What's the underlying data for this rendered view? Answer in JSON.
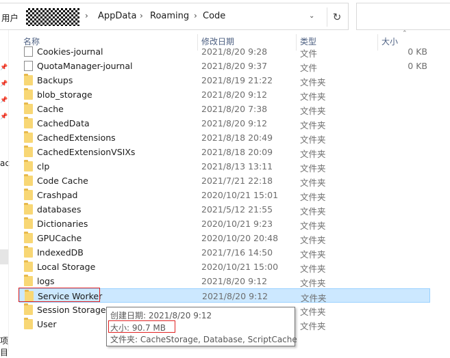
{
  "address": {
    "user_label": "用户",
    "crumbs": [
      "AppData",
      "Roaming",
      "Code"
    ],
    "separator": "›",
    "dropdown": "⌄",
    "refresh": "↻"
  },
  "nav": {
    "pin": "📌",
    "partial_label": "ac",
    "count_label": "项目"
  },
  "columns": {
    "name": "名称",
    "date": "修改日期",
    "type": "类型",
    "size": "大小"
  },
  "rows": [
    {
      "name": "Cookies-journal",
      "date": "2021/8/20 9:28",
      "type": "文件",
      "size": "0 KB",
      "kind": "file"
    },
    {
      "name": "QuotaManager-journal",
      "date": "2021/8/20 9:37",
      "type": "文件",
      "size": "0 KB",
      "kind": "file"
    },
    {
      "name": "Backups",
      "date": "2021/8/19 21:22",
      "type": "文件夹",
      "size": "",
      "kind": "folder"
    },
    {
      "name": "blob_storage",
      "date": "2021/8/20 9:12",
      "type": "文件夹",
      "size": "",
      "kind": "folder"
    },
    {
      "name": "Cache",
      "date": "2021/8/20 7:38",
      "type": "文件夹",
      "size": "",
      "kind": "folder"
    },
    {
      "name": "CachedData",
      "date": "2021/8/20 9:12",
      "type": "文件夹",
      "size": "",
      "kind": "folder"
    },
    {
      "name": "CachedExtensions",
      "date": "2021/8/18 20:49",
      "type": "文件夹",
      "size": "",
      "kind": "folder"
    },
    {
      "name": "CachedExtensionVSIXs",
      "date": "2021/8/18 20:09",
      "type": "文件夹",
      "size": "",
      "kind": "folder"
    },
    {
      "name": "clp",
      "date": "2021/8/13 13:11",
      "type": "文件夹",
      "size": "",
      "kind": "folder"
    },
    {
      "name": "Code Cache",
      "date": "2021/7/21 22:18",
      "type": "文件夹",
      "size": "",
      "kind": "folder"
    },
    {
      "name": "Crashpad",
      "date": "2020/10/21 15:01",
      "type": "文件夹",
      "size": "",
      "kind": "folder"
    },
    {
      "name": "databases",
      "date": "2021/5/12 21:55",
      "type": "文件夹",
      "size": "",
      "kind": "folder"
    },
    {
      "name": "Dictionaries",
      "date": "2020/10/21 9:23",
      "type": "文件夹",
      "size": "",
      "kind": "folder"
    },
    {
      "name": "GPUCache",
      "date": "2020/10/20 20:48",
      "type": "文件夹",
      "size": "",
      "kind": "folder"
    },
    {
      "name": "IndexedDB",
      "date": "2021/7/16 14:50",
      "type": "文件夹",
      "size": "",
      "kind": "folder"
    },
    {
      "name": "Local Storage",
      "date": "2020/10/21 15:00",
      "type": "文件夹",
      "size": "",
      "kind": "folder"
    },
    {
      "name": "logs",
      "date": "2021/8/20 9:12",
      "type": "文件夹",
      "size": "",
      "kind": "folder"
    },
    {
      "name": "Service Worker",
      "date": "2021/8/20 9:12",
      "type": "文件夹",
      "size": "",
      "kind": "folder",
      "selected": true
    },
    {
      "name": "Session Storage",
      "date": "",
      "type": "文件夹",
      "size": "",
      "kind": "folder"
    },
    {
      "name": "User",
      "date": "",
      "type": "文件夹",
      "size": "",
      "kind": "folder"
    }
  ],
  "tooltip": {
    "created": "创建日期: 2021/8/20 9:12",
    "size": "大小: 90.7 MB",
    "contents": "文件夹: CacheStorage, Database, ScriptCache"
  },
  "colors": {
    "selection": "#cce8ff",
    "highlight_box": "#e02020",
    "folder": "#f8d775"
  }
}
